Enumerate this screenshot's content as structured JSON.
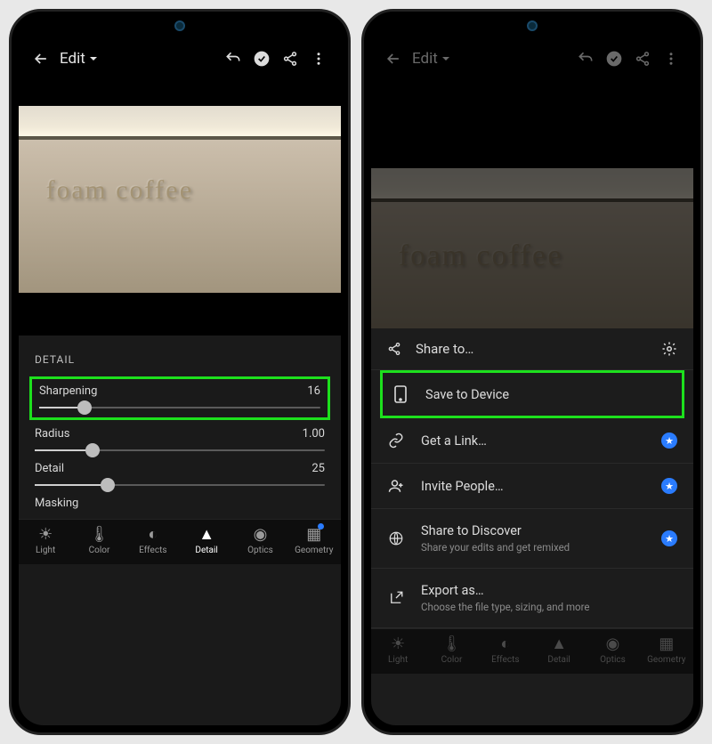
{
  "header": {
    "title": "Edit"
  },
  "photo": {
    "wall_text": "foam coffee"
  },
  "detail_panel": {
    "title": "DETAIL",
    "sliders": [
      {
        "label": "Sharpening",
        "value": "16",
        "percent": 16
      },
      {
        "label": "Radius",
        "value": "1.00",
        "percent": 20
      },
      {
        "label": "Detail",
        "value": "25",
        "percent": 25
      },
      {
        "label": "Masking",
        "value": "",
        "percent": 0
      }
    ]
  },
  "tabs": [
    {
      "label": "Light"
    },
    {
      "label": "Color"
    },
    {
      "label": "Effects"
    },
    {
      "label": "Detail"
    },
    {
      "label": "Optics"
    },
    {
      "label": "Geometry"
    }
  ],
  "share_sheet": {
    "header": "Share to…",
    "rows": [
      {
        "label": "Save to Device",
        "icon": "phone",
        "badge": false,
        "sub": ""
      },
      {
        "label": "Get a Link…",
        "icon": "link",
        "badge": true,
        "sub": ""
      },
      {
        "label": "Invite People…",
        "icon": "invite",
        "badge": true,
        "sub": ""
      },
      {
        "label": "Share to Discover",
        "icon": "globe",
        "badge": true,
        "sub": "Share your edits and get remixed"
      },
      {
        "label": "Export as…",
        "icon": "export",
        "badge": false,
        "sub": "Choose the file type, sizing, and more"
      }
    ]
  }
}
